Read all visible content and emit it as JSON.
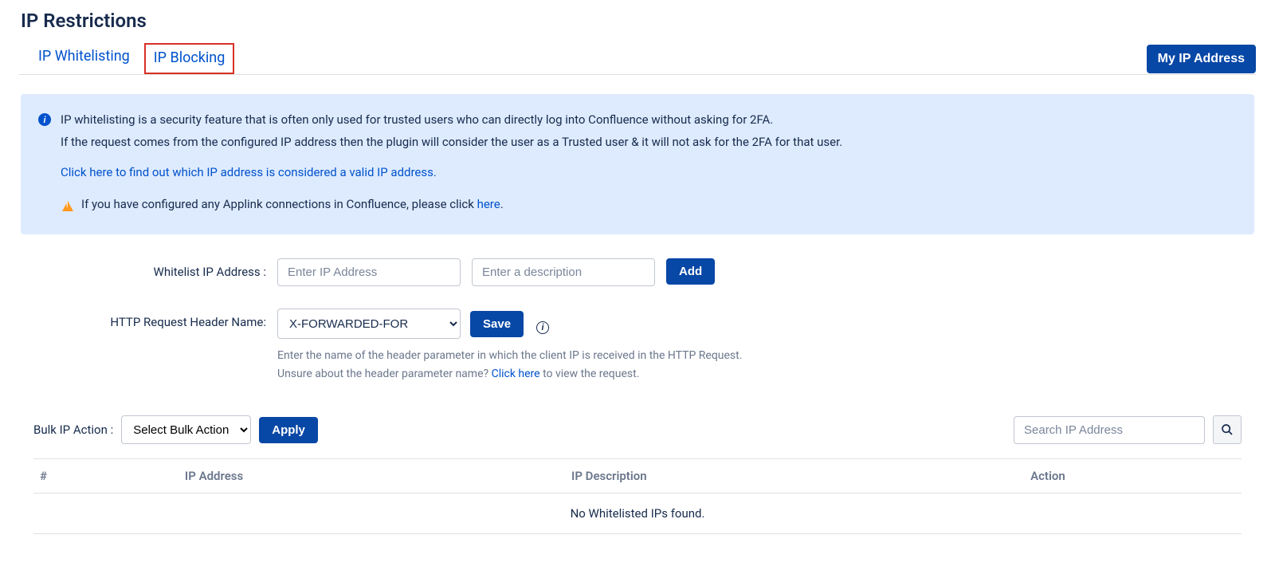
{
  "page_title": "IP Restrictions",
  "tabs": {
    "whitelisting": "IP Whitelisting",
    "blocking": "IP Blocking"
  },
  "my_ip_button": "My IP Address",
  "info": {
    "line1_a": "IP whitelisting is a security feature that is often only used for trusted users who can ",
    "line1_b": "directly log into Confluence",
    "line1_c": " without asking for 2FA.",
    "line2_a": "If the request comes from the configured IP address then the plugin will consider the user as a ",
    "line2_b": "Trusted user",
    "line2_c": " & it will not ask for the 2FA for that user.",
    "link1": "Click here to find out which IP address is considered a valid IP address.",
    "warn_a": "If you have configured any Applink connections in Confluence, please click ",
    "warn_link": "here",
    "warn_b": "."
  },
  "form": {
    "whitelist_label": "Whitelist IP Address :",
    "ip_placeholder": "Enter IP Address",
    "desc_placeholder": "Enter a description",
    "add_button": "Add",
    "header_label": "HTTP Request Header Name:",
    "header_option": "X-FORWARDED-FOR",
    "save_button": "Save",
    "help1": "Enter the name of the header parameter in which the client IP is received in the HTTP Request.",
    "help2_a": "Unsure about the header parameter name? ",
    "help2_link": "Click here",
    "help2_b": " to view the request."
  },
  "bulk": {
    "label": "Bulk IP Action :",
    "select_option": "Select Bulk Action",
    "apply_button": "Apply",
    "search_placeholder": "Search IP Address"
  },
  "table": {
    "col_index": "#",
    "col_ip": "IP Address",
    "col_desc": "IP Description",
    "col_action": "Action",
    "empty": "No Whitelisted IPs found."
  }
}
